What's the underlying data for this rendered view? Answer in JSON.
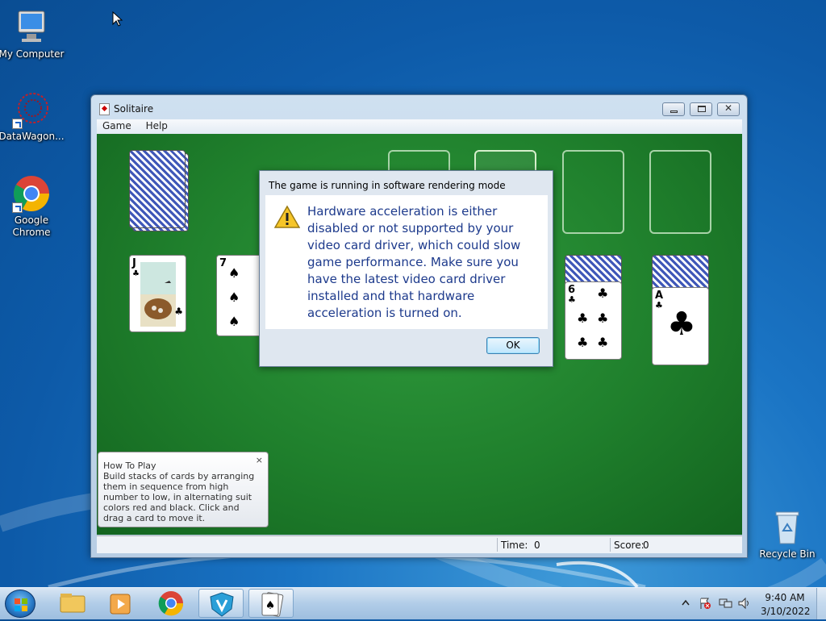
{
  "desktop": {
    "icons": [
      {
        "label": "My Computer",
        "icon": "computer-icon"
      },
      {
        "label": "DataWagon...",
        "icon": "datawagon-icon"
      },
      {
        "label": "Google Chrome",
        "icon": "chrome-icon"
      },
      {
        "label": "Recycle Bin",
        "icon": "recycle-bin-icon"
      }
    ]
  },
  "window": {
    "title": "Solitaire",
    "menu": [
      "Game",
      "Help"
    ],
    "status": {
      "time_label": "Time:",
      "time_value": "0",
      "score_label": "Score:",
      "score_value": "0"
    }
  },
  "cards": {
    "jack_rank": "J",
    "seven_rank": "7",
    "six_rank": "6",
    "ace_rank": "A"
  },
  "dialog": {
    "title": "The game is running in software rendering mode",
    "message": "Hardware acceleration is either disabled or not supported by your video card driver, which could slow game performance. Make sure you have the latest video card driver installed and that hardware acceleration is turned on.",
    "ok_label": "OK"
  },
  "tip": {
    "title": "How To Play",
    "body": "Build stacks of cards by arranging them in sequence from high number to low, in alternating suit colors red and black. Click and drag a card to move it.",
    "close": "×"
  },
  "taskbar": {
    "items": [
      "start-button",
      "explorer-icon",
      "media-player-icon",
      "chrome-icon",
      "shield-app-icon",
      "solitaire-icon"
    ],
    "time": "9:40 AM",
    "date": "3/10/2022"
  },
  "colors": {
    "felt": "#1f7f2c",
    "dialog_text": "#1d3a8c",
    "desktop": "#1a74c4"
  }
}
